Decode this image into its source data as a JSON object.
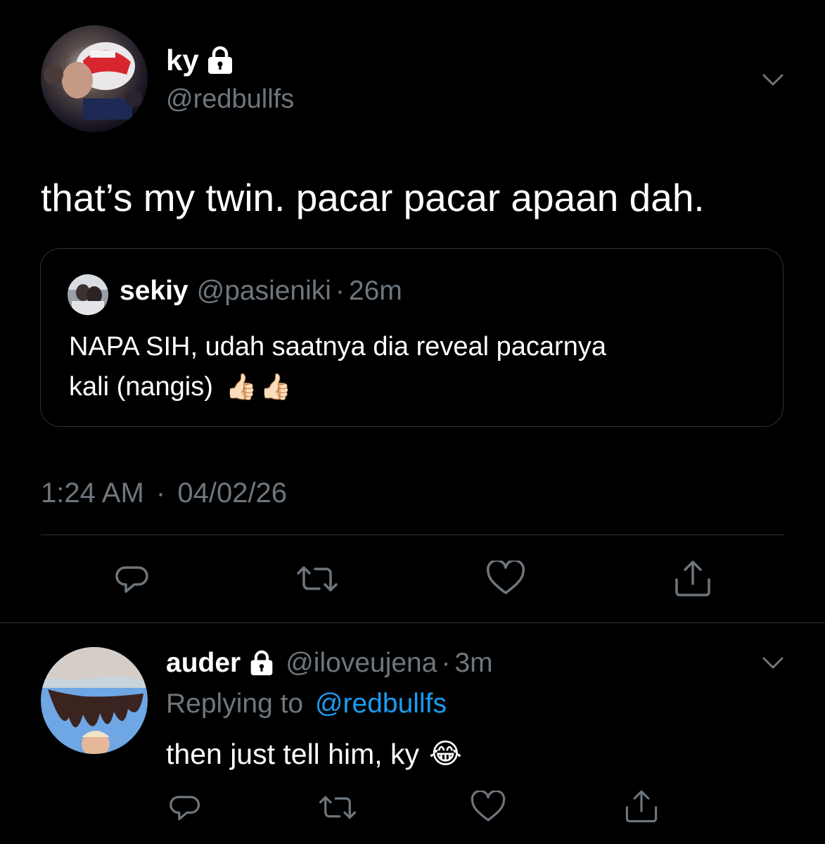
{
  "main_tweet": {
    "display_name": "ky",
    "handle": "@redbullfs",
    "protected_icon": "lock-icon",
    "menu_icon": "chevron-down-icon",
    "text": "that’s my twin. pacar pacar apaan dah.",
    "quoted": {
      "display_name": "sekiy",
      "handle": "@pasieniki",
      "separator": "·",
      "time": "26m",
      "text_line1": "NAPA SIH, udah saatnya dia reveal pacarnya",
      "text_line2": "kali (nangis)",
      "emoji": "👍🏻👍🏻"
    },
    "time": "1:24 AM",
    "date_separator": "·",
    "date": "04/02/26",
    "actions": [
      "reply-icon",
      "retweet-icon",
      "like-icon",
      "share-icon"
    ]
  },
  "reply_tweet": {
    "display_name": "auder",
    "handle": "@iloveujena",
    "separator": "·",
    "time": "3m",
    "replying_prefix": "Replying to",
    "replying_handle": "@redbullfs",
    "text": "then just tell him, ky",
    "emoji": "😂",
    "actions": [
      "reply-icon",
      "retweet-icon",
      "like-icon",
      "share-icon"
    ]
  },
  "colors": {
    "background": "#000000",
    "text": "#ffffff",
    "muted": "#6e767d",
    "link": "#1d9bf0",
    "divider": "#2f3336"
  }
}
